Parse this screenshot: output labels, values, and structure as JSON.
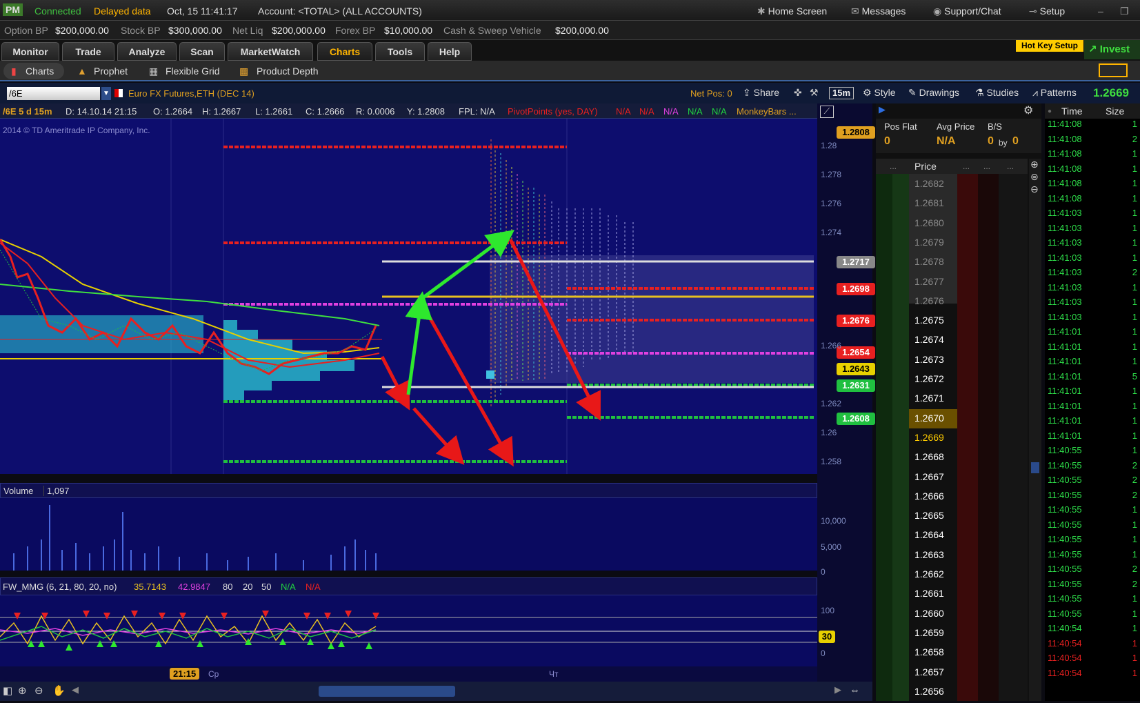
{
  "topbar": {
    "logo": "PM",
    "connected": "Connected",
    "delayed": "Delayed data",
    "datetime": "Oct, 15  11:41:17",
    "account": "Account: <TOTAL> (ALL ACCOUNTS)",
    "home": "Home Screen",
    "messages": "Messages",
    "support": "Support/Chat",
    "setup": "Setup"
  },
  "bp": {
    "option_l": "Option BP",
    "option_v": "$200,000.00",
    "stock_l": "Stock BP",
    "stock_v": "$300,000.00",
    "netliq_l": "Net Liq",
    "netliq_v": "$200,000.00",
    "forex_l": "Forex BP",
    "forex_v": "$10,000.00",
    "cash_l": "Cash & Sweep Vehicle",
    "cash_v": "$200,000.00"
  },
  "tabs": [
    "Monitor",
    "Trade",
    "Analyze",
    "Scan",
    "MarketWatch",
    "Charts",
    "Tools",
    "Help"
  ],
  "hotkey": "Hot Key Setup",
  "invest": "Invest",
  "subtabs": [
    "Charts",
    "Prophet",
    "Flexible Grid",
    "Product Depth"
  ],
  "symbol": {
    "value": "/6E",
    "desc": "Euro FX Futures,ETH (DEC 14)",
    "netpos": "Net Pos: 0",
    "share": "Share",
    "agg": "15m",
    "style": "Style",
    "drawings": "Drawings",
    "studies": "Studies",
    "patterns": "Patterns",
    "last": "1.2669"
  },
  "info": {
    "sym": "/6E 5 d 15m",
    "d": "D: 14.10.14 21:15",
    "o": "O: 1.2664",
    "h": "H: 1.2667",
    "l": "L: 1.2661",
    "c": "C: 1.2666",
    "r": "R: 0.0006",
    "y": "Y: 1.2808",
    "fpl": "FPL: N/A",
    "pivot": "PivotPoints (yes, DAY)",
    "na": "N/A",
    "monkey": "MonkeyBars ..."
  },
  "copyright": "2014 © TD Ameritrade IP Company, Inc.",
  "price_labels": [
    {
      "v": "1.2808",
      "c": "#e0a020"
    },
    {
      "v": "1.2717",
      "c": "#888"
    },
    {
      "v": "1.2698",
      "c": "#e82020"
    },
    {
      "v": "1.2676",
      "c": "#e82020"
    },
    {
      "v": "1.2654",
      "c": "#e82020"
    },
    {
      "v": "1.2643",
      "c": "#e8d000"
    },
    {
      "v": "1.2631",
      "c": "#20c040"
    },
    {
      "v": "1.2608",
      "c": "#20c040"
    }
  ],
  "axis_ticks": [
    "1.28",
    "1.278",
    "1.276",
    "1.274",
    "1.266",
    "1.262",
    "1.26",
    "1.258"
  ],
  "volume": {
    "label": "Volume",
    "value": "1,097",
    "ticks": [
      "10,000",
      "5,000",
      "0"
    ]
  },
  "fw": {
    "label": "FW_MMG (6, 21, 80, 20, no)",
    "v1": "35.7143",
    "v2": "42.9847",
    "v3": "80",
    "v4": "20",
    "v5": "50",
    "na1": "N/A",
    "na2": "N/A",
    "ticks": [
      "100",
      "0"
    ],
    "mark": "30"
  },
  "timeaxis": {
    "cursor": "21:15",
    "d1": "Ср",
    "d2": "Чт"
  },
  "ladder": {
    "pos_flat": "Pos Flat",
    "pos_v": "0",
    "avg": "Avg Price",
    "avg_v": "N/A",
    "bs": "B/S",
    "bs_v": "0",
    "by": "by",
    "bs_v2": "0",
    "price_hdr": "Price",
    "dots": "...",
    "prices": [
      "1.2682",
      "1.2681",
      "1.2680",
      "1.2679",
      "1.2678",
      "1.2677",
      "1.2676",
      "1.2675",
      "1.2674",
      "1.2673",
      "1.2672",
      "1.2671",
      "1.2670",
      "1.2669",
      "1.2668",
      "1.2667",
      "1.2666",
      "1.2665",
      "1.2664",
      "1.2663",
      "1.2662",
      "1.2661",
      "1.2660",
      "1.2659",
      "1.2658",
      "1.2657",
      "1.2656"
    ]
  },
  "tas": {
    "time_hdr": "Time",
    "size_hdr": "Size",
    "rows": [
      [
        "11:41:08",
        "1"
      ],
      [
        "11:41:08",
        "2"
      ],
      [
        "11:41:08",
        "1"
      ],
      [
        "11:41:08",
        "1"
      ],
      [
        "11:41:08",
        "1"
      ],
      [
        "11:41:08",
        "1"
      ],
      [
        "11:41:03",
        "1"
      ],
      [
        "11:41:03",
        "1"
      ],
      [
        "11:41:03",
        "1"
      ],
      [
        "11:41:03",
        "1"
      ],
      [
        "11:41:03",
        "2"
      ],
      [
        "11:41:03",
        "1"
      ],
      [
        "11:41:03",
        "1"
      ],
      [
        "11:41:03",
        "1"
      ],
      [
        "11:41:01",
        "1"
      ],
      [
        "11:41:01",
        "1"
      ],
      [
        "11:41:01",
        "1"
      ],
      [
        "11:41:01",
        "5"
      ],
      [
        "11:41:01",
        "1"
      ],
      [
        "11:41:01",
        "1"
      ],
      [
        "11:41:01",
        "1"
      ],
      [
        "11:41:01",
        "1"
      ],
      [
        "11:40:55",
        "1"
      ],
      [
        "11:40:55",
        "2"
      ],
      [
        "11:40:55",
        "2"
      ],
      [
        "11:40:55",
        "2"
      ],
      [
        "11:40:55",
        "1"
      ],
      [
        "11:40:55",
        "1"
      ],
      [
        "11:40:55",
        "1"
      ],
      [
        "11:40:55",
        "1"
      ],
      [
        "11:40:55",
        "2"
      ],
      [
        "11:40:55",
        "2"
      ],
      [
        "11:40:55",
        "1"
      ],
      [
        "11:40:55",
        "1"
      ],
      [
        "11:40:54",
        "1"
      ],
      [
        "11:40:54",
        "1"
      ],
      [
        "11:40:54",
        "1"
      ],
      [
        "11:40:54",
        "1"
      ]
    ]
  }
}
